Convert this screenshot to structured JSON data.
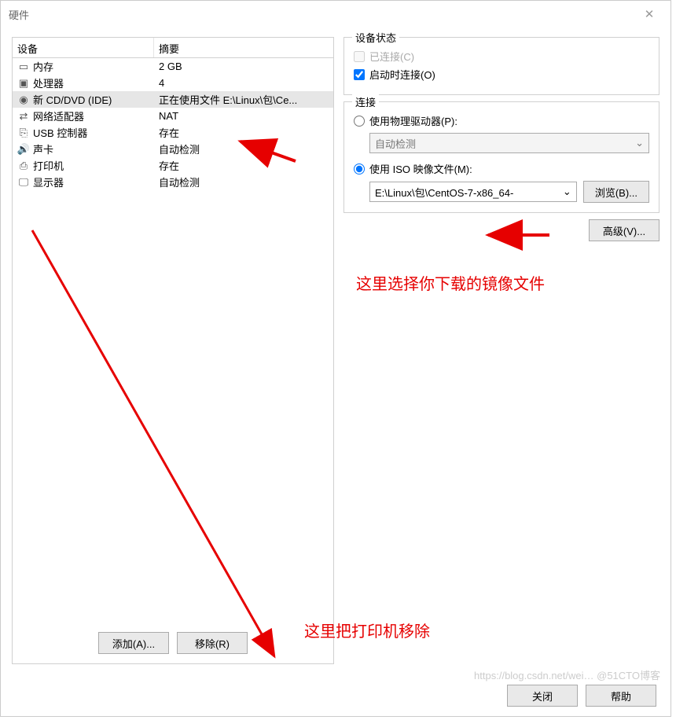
{
  "window": {
    "title": "硬件"
  },
  "hw_table": {
    "col_device": "设备",
    "col_summary": "摘要",
    "rows": [
      {
        "icon": "memory-icon",
        "device": "内存",
        "summary": "2 GB",
        "selected": false
      },
      {
        "icon": "cpu-icon",
        "device": "处理器",
        "summary": "4",
        "selected": false
      },
      {
        "icon": "cd-icon",
        "device": "新 CD/DVD (IDE)",
        "summary": "正在使用文件 E:\\Linux\\包\\Ce...",
        "selected": true
      },
      {
        "icon": "network-icon",
        "device": "网络适配器",
        "summary": "NAT",
        "selected": false
      },
      {
        "icon": "usb-icon",
        "device": "USB 控制器",
        "summary": "存在",
        "selected": false
      },
      {
        "icon": "sound-icon",
        "device": "声卡",
        "summary": "自动检测",
        "selected": false
      },
      {
        "icon": "printer-icon",
        "device": "打印机",
        "summary": "存在",
        "selected": false
      },
      {
        "icon": "display-icon",
        "device": "显示器",
        "summary": "自动检测",
        "selected": false
      }
    ]
  },
  "left_buttons": {
    "add": "添加(A)...",
    "remove": "移除(R)"
  },
  "device_status": {
    "legend": "设备状态",
    "connected_label": "已连接(C)",
    "connected_checked": false,
    "connected_disabled": true,
    "connect_on_power_label": "启动时连接(O)",
    "connect_on_power_checked": true
  },
  "connection": {
    "legend": "连接",
    "physical_label": "使用物理驱动器(P):",
    "physical_selected": false,
    "physical_dropdown_value": "自动检测",
    "iso_label": "使用 ISO 映像文件(M):",
    "iso_selected": true,
    "iso_dropdown_value": "E:\\Linux\\包\\CentOS-7-x86_64-",
    "browse_label": "浏览(B)..."
  },
  "advanced_button": "高级(V)...",
  "footer": {
    "close": "关闭",
    "help": "帮助"
  },
  "annotations": {
    "select_image": "这里选择你下载的镜像文件",
    "remove_printer": "这里把打印机移除"
  },
  "watermark": "https://blog.csdn.net/wei… @51CTO博客",
  "dropdown_caret": "⌄"
}
